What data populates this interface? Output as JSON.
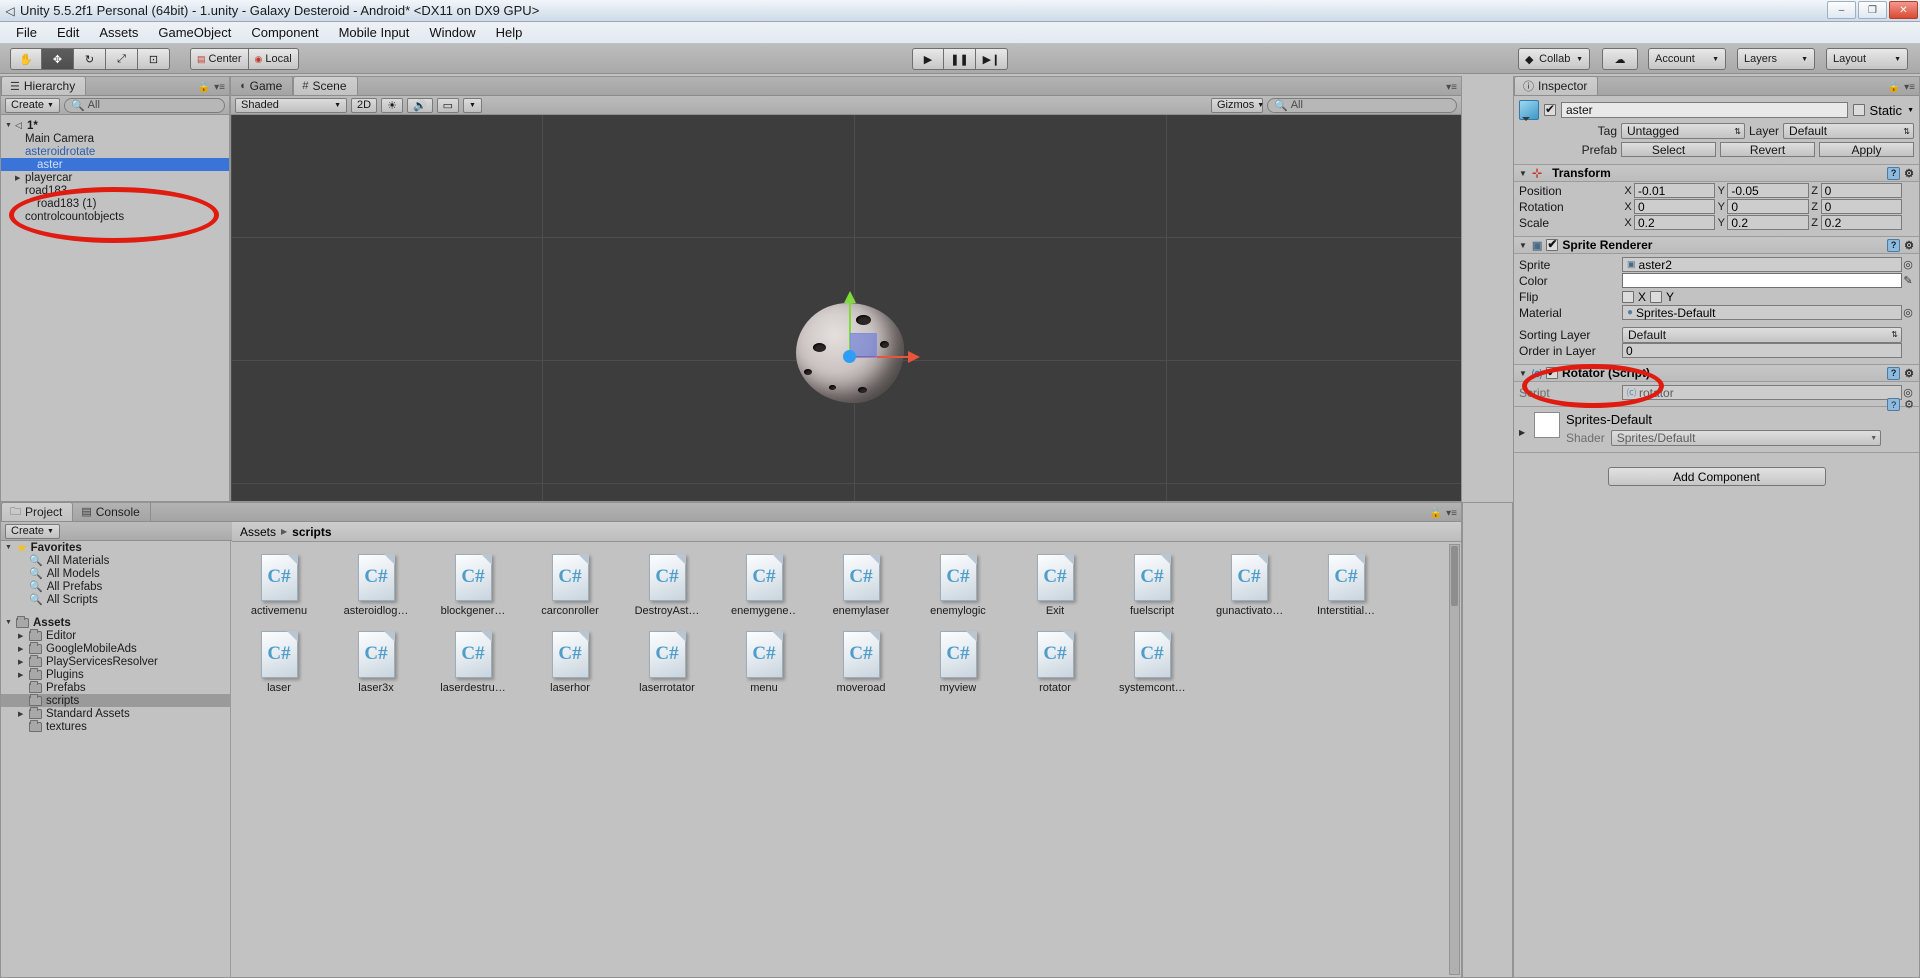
{
  "window": {
    "title": "Unity 5.5.2f1 Personal (64bit) - 1.unity - Galaxy Desteroid - Android* <DX11 on DX9 GPU>",
    "minimize": "–",
    "maximize": "❐",
    "close": "✕"
  },
  "menubar": {
    "items": [
      "File",
      "Edit",
      "Assets",
      "GameObject",
      "Component",
      "Mobile Input",
      "Window",
      "Help"
    ]
  },
  "toolbar": {
    "tools": [
      {
        "name": "hand-tool",
        "glyph": "✋",
        "active": false
      },
      {
        "name": "move-tool",
        "glyph": "✥",
        "active": true
      },
      {
        "name": "rotate-tool",
        "glyph": "↻",
        "active": false
      },
      {
        "name": "scale-tool",
        "glyph": "⤢",
        "active": false
      },
      {
        "name": "rect-tool",
        "glyph": "⊡",
        "active": false
      }
    ],
    "pivot_mode": "Center",
    "pivot_rotation": "Local",
    "play": "▶",
    "pause": "❚❚",
    "step": "▶❙",
    "collab": "Collab",
    "cloud": "☁",
    "account": "Account",
    "layers": "Layers",
    "layout": "Layout"
  },
  "hierarchy": {
    "tab": "Hierarchy",
    "create": "Create",
    "search_placeholder": "All",
    "scene_name": "1*",
    "items": [
      {
        "label": "Main Camera",
        "depth": 1,
        "arrow": false,
        "selected": false,
        "prefab": false
      },
      {
        "label": "asteroidrotate",
        "depth": 1,
        "arrow": false,
        "selected": false,
        "prefab": true
      },
      {
        "label": "aster",
        "depth": 2,
        "arrow": false,
        "selected": true,
        "prefab": true
      },
      {
        "label": "playercar",
        "depth": 1,
        "arrow": true,
        "selected": false,
        "prefab": false
      },
      {
        "label": "road183",
        "depth": 1,
        "arrow": false,
        "selected": false,
        "prefab": false
      },
      {
        "label": "road183 (1)",
        "depth": 2,
        "arrow": false,
        "selected": false,
        "prefab": false
      },
      {
        "label": "controlcountobjects",
        "depth": 1,
        "arrow": false,
        "selected": false,
        "prefab": false
      }
    ]
  },
  "scene": {
    "tabs": [
      {
        "label": "Game",
        "icon": "game-icon",
        "selected": false
      },
      {
        "label": "Scene",
        "icon": "scene-icon",
        "selected": true
      }
    ],
    "draw_mode": "Shaded",
    "mode_2d": "2D",
    "lighting": "☀",
    "audio": "🔊",
    "fx": "▭",
    "gizmos": "Gizmos",
    "search_placeholder": "All"
  },
  "inspector": {
    "tab": "Inspector",
    "object_name": "aster",
    "enabled": true,
    "static_label": "Static",
    "tag_label": "Tag",
    "tag_value": "Untagged",
    "layer_label": "Layer",
    "layer_value": "Default",
    "prefab_label": "Prefab",
    "prefab_buttons": [
      "Select",
      "Revert",
      "Apply"
    ],
    "transform": {
      "title": "Transform",
      "rows": [
        {
          "label": "Position",
          "x": "-0.01",
          "y": "-0.05",
          "z": "0"
        },
        {
          "label": "Rotation",
          "x": "0",
          "y": "0",
          "z": "0"
        },
        {
          "label": "Scale",
          "x": "0.2",
          "y": "0.2",
          "z": "0.2"
        }
      ]
    },
    "sprite_renderer": {
      "title": "Sprite Renderer",
      "enabled": true,
      "sprite_label": "Sprite",
      "sprite_value": "aster2",
      "color_label": "Color",
      "flip_label": "Flip",
      "flip_x": "X",
      "flip_y": "Y",
      "material_label": "Material",
      "material_value": "Sprites-Default",
      "sorting_layer_label": "Sorting Layer",
      "sorting_layer_value": "Default",
      "order_label": "Order in Layer",
      "order_value": "0"
    },
    "rotator_script": {
      "title": "Rotator (Script)",
      "enabled": true,
      "script_label": "Script",
      "script_value": "rotator"
    },
    "material": {
      "title": "Sprites-Default",
      "shader_label": "Shader",
      "shader_value": "Sprites/Default"
    },
    "add_component": "Add Component"
  },
  "project": {
    "tabs": [
      {
        "label": "Project",
        "icon": "project-icon",
        "selected": true
      },
      {
        "label": "Console",
        "icon": "console-icon",
        "selected": false
      }
    ],
    "create": "Create",
    "search_placeholder": "",
    "tree": [
      {
        "label": "Favorites",
        "icon": "star",
        "depth": 0,
        "arrow": "▼",
        "bold": true,
        "selected": false
      },
      {
        "label": "All Materials",
        "icon": "search",
        "depth": 1,
        "arrow": "",
        "bold": false,
        "selected": false
      },
      {
        "label": "All Models",
        "icon": "search",
        "depth": 1,
        "arrow": "",
        "bold": false,
        "selected": false
      },
      {
        "label": "All Prefabs",
        "icon": "search",
        "depth": 1,
        "arrow": "",
        "bold": false,
        "selected": false
      },
      {
        "label": "All Scripts",
        "icon": "search",
        "depth": 1,
        "arrow": "",
        "bold": false,
        "selected": false
      },
      {
        "label": "",
        "icon": "",
        "depth": 0,
        "arrow": "",
        "bold": false,
        "selected": false
      },
      {
        "label": "Assets",
        "icon": "folder",
        "depth": 0,
        "arrow": "▼",
        "bold": true,
        "selected": false
      },
      {
        "label": "Editor",
        "icon": "folder",
        "depth": 1,
        "arrow": "▶",
        "bold": false,
        "selected": false
      },
      {
        "label": "GoogleMobileAds",
        "icon": "folder",
        "depth": 1,
        "arrow": "▶",
        "bold": false,
        "selected": false
      },
      {
        "label": "PlayServicesResolver",
        "icon": "folder",
        "depth": 1,
        "arrow": "▶",
        "bold": false,
        "selected": false
      },
      {
        "label": "Plugins",
        "icon": "folder",
        "depth": 1,
        "arrow": "▶",
        "bold": false,
        "selected": false
      },
      {
        "label": "Prefabs",
        "icon": "folder",
        "depth": 1,
        "arrow": "",
        "bold": false,
        "selected": false
      },
      {
        "label": "scripts",
        "icon": "folder",
        "depth": 1,
        "arrow": "",
        "bold": false,
        "selected": true
      },
      {
        "label": "Standard Assets",
        "icon": "folder",
        "depth": 1,
        "arrow": "▶",
        "bold": false,
        "selected": false
      },
      {
        "label": "textures",
        "icon": "folder",
        "depth": 1,
        "arrow": "",
        "bold": false,
        "selected": false
      }
    ],
    "breadcrumb": [
      "Assets",
      "scripts"
    ],
    "assets": [
      {
        "name": "activemenu",
        "type": "csharp"
      },
      {
        "name": "asteroidlog…",
        "type": "csharp"
      },
      {
        "name": "blockgener…",
        "type": "csharp"
      },
      {
        "name": "carconroller",
        "type": "csharp"
      },
      {
        "name": "DestroyAst…",
        "type": "csharp"
      },
      {
        "name": "enemygene…",
        "type": "csharp"
      },
      {
        "name": "enemylaser",
        "type": "csharp"
      },
      {
        "name": "enemylogic",
        "type": "csharp"
      },
      {
        "name": "Exit",
        "type": "csharp"
      },
      {
        "name": "fuelscript",
        "type": "csharp"
      },
      {
        "name": "gunactivato…",
        "type": "csharp"
      },
      {
        "name": "Interstitial…",
        "type": "csharp"
      },
      {
        "name": "laser",
        "type": "csharp"
      },
      {
        "name": "laser3x",
        "type": "csharp"
      },
      {
        "name": "laserdestru…",
        "type": "csharp"
      },
      {
        "name": "laserhor",
        "type": "csharp"
      },
      {
        "name": "laserrotator",
        "type": "csharp"
      },
      {
        "name": "menu",
        "type": "csharp"
      },
      {
        "name": "moveroad",
        "type": "csharp"
      },
      {
        "name": "myview",
        "type": "csharp"
      },
      {
        "name": "rotator",
        "type": "csharp"
      },
      {
        "name": "systemcont…",
        "type": "csharp"
      }
    ],
    "csharp_glyph": "C#"
  },
  "colors": {
    "selection_blue": "#3a74d8",
    "annotation_red": "#e01b10",
    "gizmo_green": "#7ddc3a",
    "gizmo_red": "#e8553a",
    "gizmo_blue": "#2e9ef5"
  }
}
